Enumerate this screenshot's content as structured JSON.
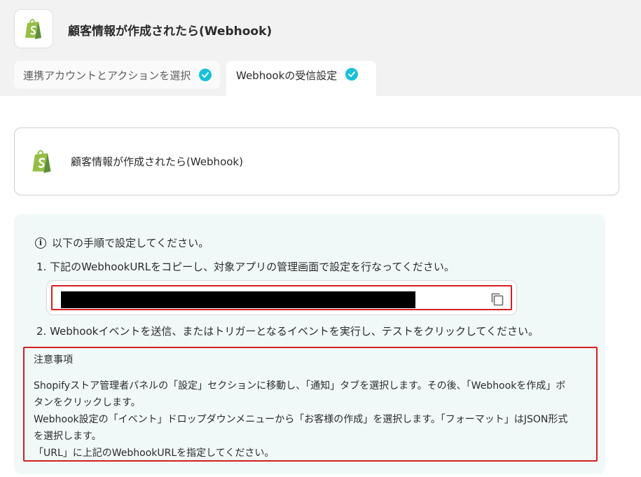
{
  "header": {
    "title": "顧客情報が作成されたら(Webhook)"
  },
  "tabs": [
    {
      "label": "連携アカウントとアクションを選択"
    },
    {
      "label": "Webhookの受信設定"
    }
  ],
  "app_card": {
    "title": "顧客情報が作成されたら(Webhook)"
  },
  "instructions": {
    "intro": "以下の手順で設定してください。",
    "info_icon_glyph": "i",
    "step1": "1. 下記のWebhookURLをコピーし、対象アプリの管理画面で設定を行なってください。",
    "step2": "2. Webhookイベントを送信、またはトリガーとなるイベントを実行し、テストをクリックしてください。",
    "webhook_url": ""
  },
  "notes": {
    "title": "注意事項",
    "lines": [
      "Shopifyストア管理者パネルの「設定」セクションに移動し、「通知」タブを選択します。その後、「Webhookを作成」ボ",
      "タンをクリックします。",
      "Webhook設定の「イベント」ドロップダウンメニューから「お客様の作成」を選択します。「フォーマット」はJSON形式",
      "を選択します。",
      "「URL」に上記のWebhookURLを指定してください。"
    ]
  },
  "colors": {
    "accent_check": "#19c0d8",
    "highlight_border": "#d42020",
    "panel_bg": "#f1f9f8",
    "shopify_green": "#95bf47"
  },
  "icons": [
    "shopify-logo-icon",
    "check-icon",
    "info-icon",
    "copy-icon"
  ]
}
